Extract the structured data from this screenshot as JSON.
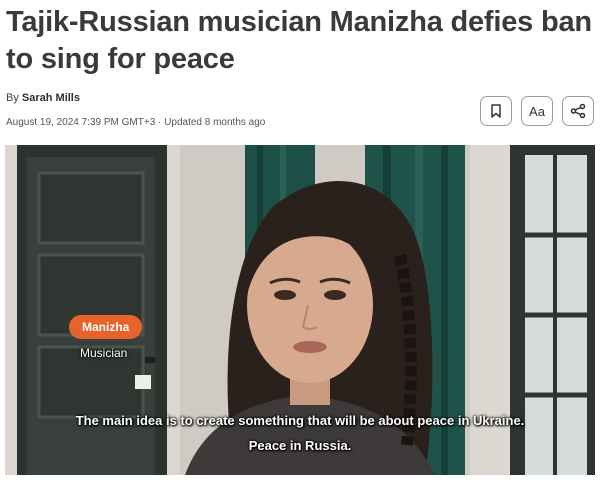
{
  "article": {
    "headline": "Tajik-Russian musician Manizha defies ban to sing for peace",
    "byline_prefix": "By",
    "author": "Sarah Mills",
    "date": "August 19, 2024 7:39 PM GMT+3",
    "separator": "·",
    "updated": "Updated 8 months ago"
  },
  "tools": {
    "bookmark_icon": "bookmark-icon",
    "text_size_label": "Aa",
    "share_icon": "share-icon"
  },
  "video": {
    "speaker_name": "Manizha",
    "speaker_role": "Musician",
    "subtitle_line1": "The main idea is to create something that will be about peace in Ukraine.",
    "subtitle_line2": "Peace in Russia.",
    "accent_color": "#e8622b"
  }
}
